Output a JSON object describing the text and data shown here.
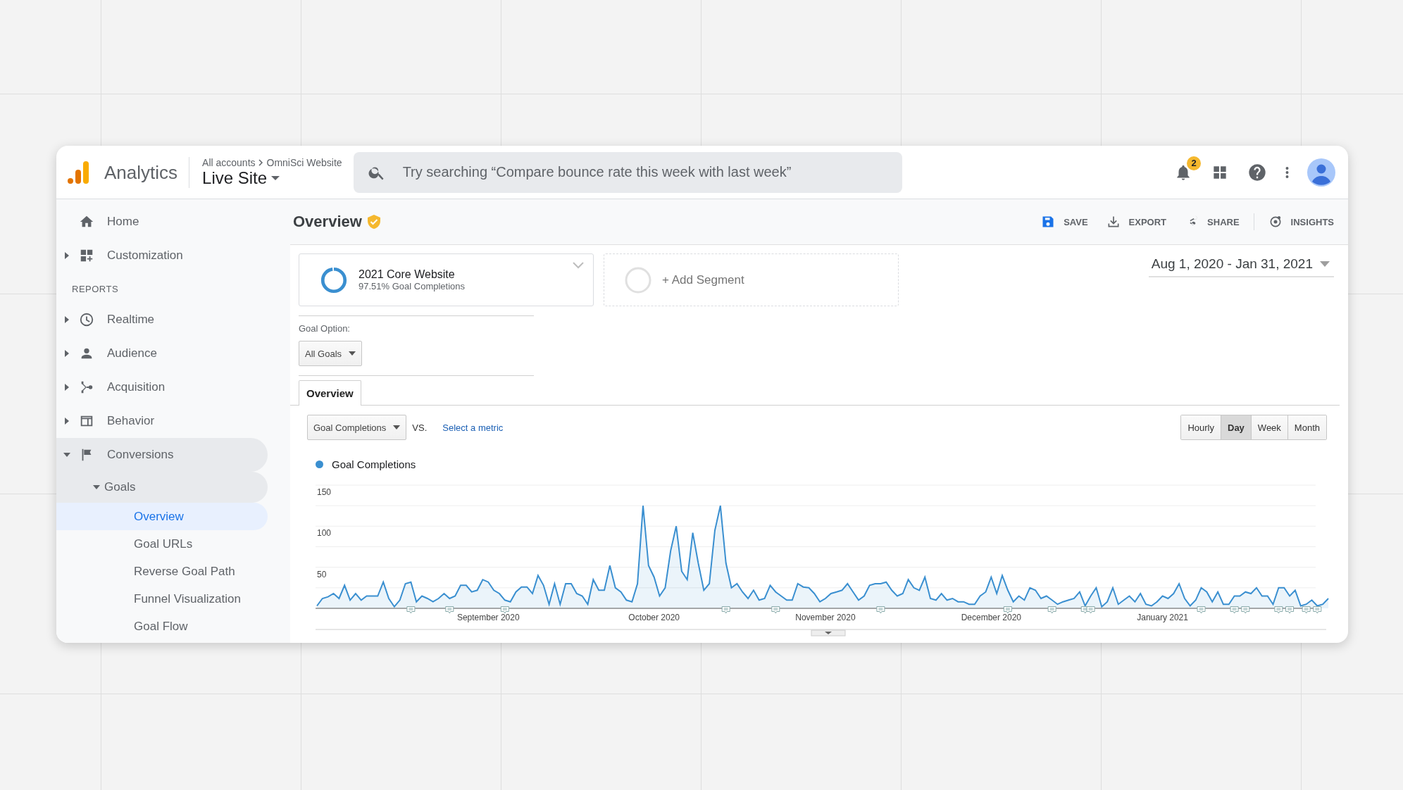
{
  "header": {
    "product": "Analytics",
    "breadcrumb": [
      "All accounts",
      "OmniSci Website"
    ],
    "property": "Live Site",
    "search": {
      "placeholder": "Try searching “Compare bounce rate this week with last week”"
    },
    "notifications": "2"
  },
  "sidebar": {
    "items": [
      {
        "label": "Home",
        "selected": false
      },
      {
        "label": "Customization",
        "expanded": false,
        "selected": false
      }
    ],
    "section": "REPORTS",
    "reports": [
      {
        "label": "Realtime",
        "expanded": false,
        "selected": false
      },
      {
        "label": "Audience",
        "expanded": false,
        "selected": false
      },
      {
        "label": "Acquisition",
        "expanded": false,
        "selected": false
      },
      {
        "label": "Behavior",
        "expanded": false,
        "selected": false
      },
      {
        "label": "Conversions",
        "expanded": true,
        "selected": false,
        "children": [
          {
            "label": "Goals",
            "expanded": true,
            "selected": false,
            "children": [
              {
                "label": "Overview",
                "selected": true
              },
              {
                "label": "Goal URLs",
                "selected": false
              },
              {
                "label": "Reverse Goal Path",
                "selected": false
              },
              {
                "label": "Funnel Visualization",
                "selected": false
              },
              {
                "label": "Goal Flow",
                "selected": false
              }
            ]
          }
        ]
      }
    ]
  },
  "page": {
    "title": "Overview",
    "actions": [
      {
        "label": "SAVE"
      },
      {
        "label": "EXPORT"
      },
      {
        "label": "SHARE"
      },
      {
        "label": "INSIGHTS"
      }
    ]
  },
  "segments": [
    {
      "kind": "segment",
      "name": "2021 Core Website",
      "detail": "97.51% Goal Completions",
      "level": 0.9751
    },
    {
      "kind": "add",
      "name": "+ Add Segment"
    }
  ],
  "date_range": "Aug 1, 2020 - Jan 31, 2021",
  "goal_option": {
    "label": "Goal Option:",
    "value": "All Goals"
  },
  "tabs": [
    {
      "label": "Overview",
      "selected": true
    }
  ],
  "metric": {
    "value": "Goal Completions",
    "vs": "VS.",
    "link": "Select a metric"
  },
  "periods": [
    {
      "label": "Hourly",
      "selected": false
    },
    {
      "label": "Day",
      "selected": true
    },
    {
      "label": "Week",
      "selected": false
    },
    {
      "label": "Month",
      "selected": false
    }
  ],
  "chart": {
    "chart_data": {
      "type": "area",
      "categories": [
        null,
        null,
        null,
        null,
        null,
        null,
        null,
        null,
        null,
        null,
        null,
        null,
        null,
        null,
        null,
        null,
        null,
        null,
        null,
        null,
        null,
        null,
        null,
        null,
        null,
        null,
        null,
        null,
        null,
        null,
        null,
        "September 2020",
        null,
        null,
        null,
        null,
        null,
        null,
        null,
        null,
        null,
        null,
        null,
        null,
        null,
        null,
        null,
        null,
        null,
        null,
        null,
        null,
        null,
        null,
        null,
        null,
        null,
        null,
        null,
        null,
        null,
        "October 2020",
        null,
        null,
        null,
        null,
        null,
        null,
        null,
        null,
        null,
        null,
        null,
        null,
        null,
        null,
        null,
        null,
        null,
        null,
        null,
        null,
        null,
        null,
        null,
        null,
        null,
        null,
        null,
        null,
        null,
        null,
        "November 2020",
        null,
        null,
        null,
        null,
        null,
        null,
        null,
        null,
        null,
        null,
        null,
        null,
        null,
        null,
        null,
        null,
        null,
        null,
        null,
        null,
        null,
        null,
        null,
        null,
        null,
        null,
        null,
        null,
        null,
        "December 2020",
        null,
        null,
        null,
        null,
        null,
        null,
        null,
        null,
        null,
        null,
        null,
        null,
        null,
        null,
        null,
        null,
        null,
        null,
        null,
        null,
        null,
        null,
        null,
        null,
        null,
        null,
        null,
        null,
        null,
        null,
        "January 2021",
        null,
        null,
        null,
        null,
        null,
        null,
        null,
        null,
        null,
        null,
        null,
        null,
        null,
        null,
        null,
        null,
        null,
        null,
        null,
        null,
        null,
        null,
        null,
        null,
        null,
        null,
        null,
        null,
        null,
        null
      ],
      "ylim": [
        0,
        150
      ],
      "yticks": [
        50,
        100,
        150
      ],
      "series": [
        {
          "name": "Goal Completions",
          "color": "#3a8fd0",
          "values": [
            3,
            12,
            14,
            18,
            12,
            28,
            10,
            18,
            10,
            15,
            15,
            15,
            32,
            12,
            2,
            10,
            30,
            32,
            8,
            15,
            12,
            8,
            12,
            18,
            12,
            15,
            28,
            28,
            20,
            22,
            35,
            32,
            22,
            18,
            10,
            8,
            20,
            26,
            26,
            18,
            40,
            28,
            5,
            30,
            5,
            30,
            30,
            18,
            15,
            5,
            35,
            22,
            22,
            52,
            25,
            20,
            10,
            8,
            30,
            125,
            52,
            38,
            15,
            25,
            70,
            100,
            45,
            35,
            92,
            55,
            22,
            30,
            95,
            125,
            55,
            25,
            30,
            20,
            12,
            22,
            10,
            12,
            28,
            20,
            15,
            10,
            10,
            30,
            26,
            25,
            18,
            8,
            12,
            18,
            20,
            22,
            30,
            20,
            10,
            15,
            28,
            30,
            30,
            32,
            22,
            15,
            18,
            35,
            25,
            22,
            38,
            12,
            10,
            18,
            10,
            12,
            8,
            8,
            5,
            5,
            15,
            20,
            38,
            18,
            40,
            22,
            8,
            15,
            10,
            25,
            22,
            12,
            15,
            10,
            5,
            8,
            10,
            12,
            20,
            3,
            15,
            25,
            2,
            8,
            25,
            5,
            10,
            15,
            8,
            18,
            5,
            3,
            8,
            15,
            12,
            18,
            30,
            12,
            3,
            10,
            25,
            20,
            8,
            20,
            5,
            5,
            15,
            15,
            20,
            18,
            25,
            15,
            15,
            5,
            25,
            25,
            15,
            22,
            3,
            5,
            10,
            3,
            5,
            12
          ]
        }
      ]
    }
  }
}
